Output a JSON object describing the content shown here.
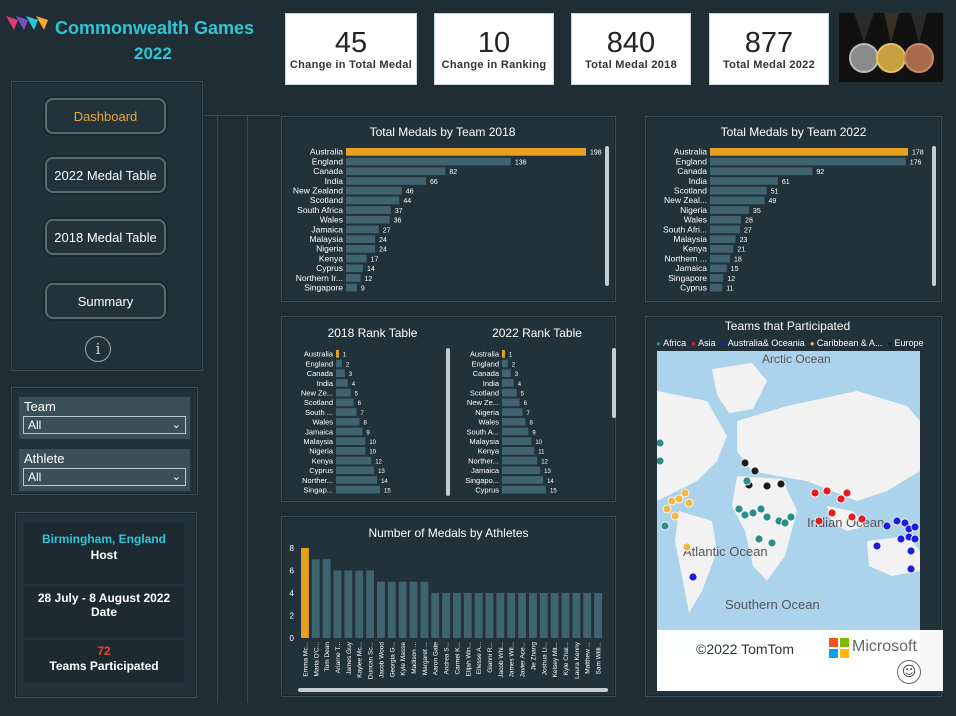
{
  "header": {
    "title": "Commonwealth Games",
    "year": "2022"
  },
  "kpis": [
    {
      "value": "45",
      "label": "Change in Total Medal",
      "arrow": "⬇"
    },
    {
      "value": "10",
      "label": "Change in Ranking",
      "arrow": "⬇"
    },
    {
      "value": "840",
      "label": "Total Medal 2018"
    },
    {
      "value": "877",
      "label": "Total Medal 2022"
    }
  ],
  "nav": {
    "dashboard": "Dashboard",
    "medal2022": "2022 Medal Table",
    "medal2018": "2018 Medal Table",
    "summary": "Summary",
    "info": "i"
  },
  "filters": {
    "team_label": "Team",
    "team_value": "All",
    "athlete_label": "Athlete",
    "athlete_value": "All"
  },
  "info": {
    "host_value": "Birmingham, England",
    "host_label": "Host",
    "date_value": "28 July - 8 August 2022",
    "date_label": "Date",
    "teams_value": "72",
    "teams_label": "Teams Participated"
  },
  "map": {
    "title": "Teams that Participated",
    "legend": [
      {
        "name": "Africa",
        "color": "#2b8c8c"
      },
      {
        "name": "Asia",
        "color": "#e21b1b"
      },
      {
        "name": "Australia& Oceania",
        "color": "#1b1be0"
      },
      {
        "name": "Caribbean & A...",
        "color": "#f3b73f"
      },
      {
        "name": "Europe",
        "color": "#1a1a1a"
      }
    ],
    "labels": {
      "arctic": "Arctic Ocean",
      "indian": "Indian Ocean",
      "atlantic": "Atlantic Ocean",
      "southern": "Southern Ocean"
    },
    "copyright": "©2022 TomTom",
    "brand": "Microsoft"
  },
  "chart_data": [
    {
      "type": "bar",
      "title": "Total Medals by Team 2018",
      "orientation": "horizontal",
      "categories": [
        "Australia",
        "England",
        "Canada",
        "India",
        "New Zealand",
        "Scotland",
        "South Africa",
        "Wales",
        "Jamaica",
        "Malaysia",
        "Nigeria",
        "Kenya",
        "Cyprus",
        "Northern Ir...",
        "Singapore"
      ],
      "values": [
        198,
        136,
        82,
        66,
        46,
        44,
        37,
        36,
        27,
        24,
        24,
        17,
        14,
        12,
        9
      ],
      "highlight": "#e8a020",
      "color": "#3f6470"
    },
    {
      "type": "bar",
      "title": "Total Medals by Team 2022",
      "orientation": "horizontal",
      "categories": [
        "Australia",
        "England",
        "Canada",
        "India",
        "Scotland",
        "New Zeal...",
        "Nigeria",
        "Wales",
        "South Afri...",
        "Malaysia",
        "Kenya",
        "Northern ...",
        "Jamaica",
        "Singapore",
        "Cyprus"
      ],
      "values": [
        178,
        176,
        92,
        61,
        51,
        49,
        35,
        28,
        27,
        23,
        21,
        18,
        15,
        12,
        11
      ],
      "highlight": "#e8a020",
      "color": "#3f6470"
    },
    {
      "type": "bar",
      "title": "2018 Rank Table",
      "orientation": "horizontal",
      "categories": [
        "Australia",
        "England",
        "Canada",
        "India",
        "New Ze...",
        "Scotland",
        "South ...",
        "Wales",
        "Jamaica",
        "Malaysia",
        "Nigeria",
        "Kenya",
        "Cyprus",
        "Norther...",
        "Singap..."
      ],
      "values": [
        1,
        2,
        3,
        4,
        5,
        6,
        7,
        8,
        9,
        10,
        10,
        12,
        13,
        14,
        15
      ],
      "highlight": "#e8a020",
      "color": "#3f6470"
    },
    {
      "type": "bar",
      "title": "2022 Rank Table",
      "orientation": "horizontal",
      "categories": [
        "Australia",
        "England",
        "Canada",
        "India",
        "Scotland",
        "New Ze...",
        "Nigeria",
        "Wales",
        "South A...",
        "Malaysia",
        "Kenya",
        "Norther...",
        "Jamaica",
        "Singapo...",
        "Cyprus"
      ],
      "values": [
        1,
        2,
        3,
        4,
        5,
        6,
        7,
        8,
        9,
        10,
        11,
        12,
        13,
        14,
        15
      ],
      "highlight": "#e8a020",
      "color": "#3f6470"
    },
    {
      "type": "bar",
      "title": "Number of Medals by Athletes",
      "orientation": "vertical",
      "categories": [
        "Emma Mc...",
        "Maria O'C...",
        "Tom Dean",
        "Ariarne T...",
        "James Guy",
        "Kaylee Mc...",
        "Duncan Sc...",
        "Jacob Wood",
        "Georgia G...",
        "Kyle Masse",
        "Madison ...",
        "Margaret ...",
        "Aaron Gate",
        "Andrea S...",
        "Carmel K...",
        "Elijah Win...",
        "Ellesse A...",
        "Gianni R...",
        "Jacob Whi...",
        "James Wil...",
        "Javier Ace...",
        "Jie Zhang",
        "Joshua Li...",
        "Kelsey Mit...",
        "Kyle Chal...",
        "Laura Kenny",
        "Matthew ...",
        "Sam Willi..."
      ],
      "values": [
        8,
        7,
        7,
        6,
        6,
        6,
        6,
        5,
        5,
        5,
        5,
        5,
        4,
        4,
        4,
        4,
        4,
        4,
        4,
        4,
        4,
        4,
        4,
        4,
        4,
        4,
        4,
        4
      ],
      "ylim": [
        0,
        8
      ],
      "yticks": [
        0,
        2,
        4,
        6,
        8
      ],
      "highlight": "#e8a020",
      "color": "#3f6470"
    }
  ],
  "map_points": {
    "africa": "#2b8c8c",
    "asia": "#e21b1b",
    "oceania": "#1b1be0",
    "caribbean": "#f3b73f",
    "europe": "#1a1a1a"
  }
}
